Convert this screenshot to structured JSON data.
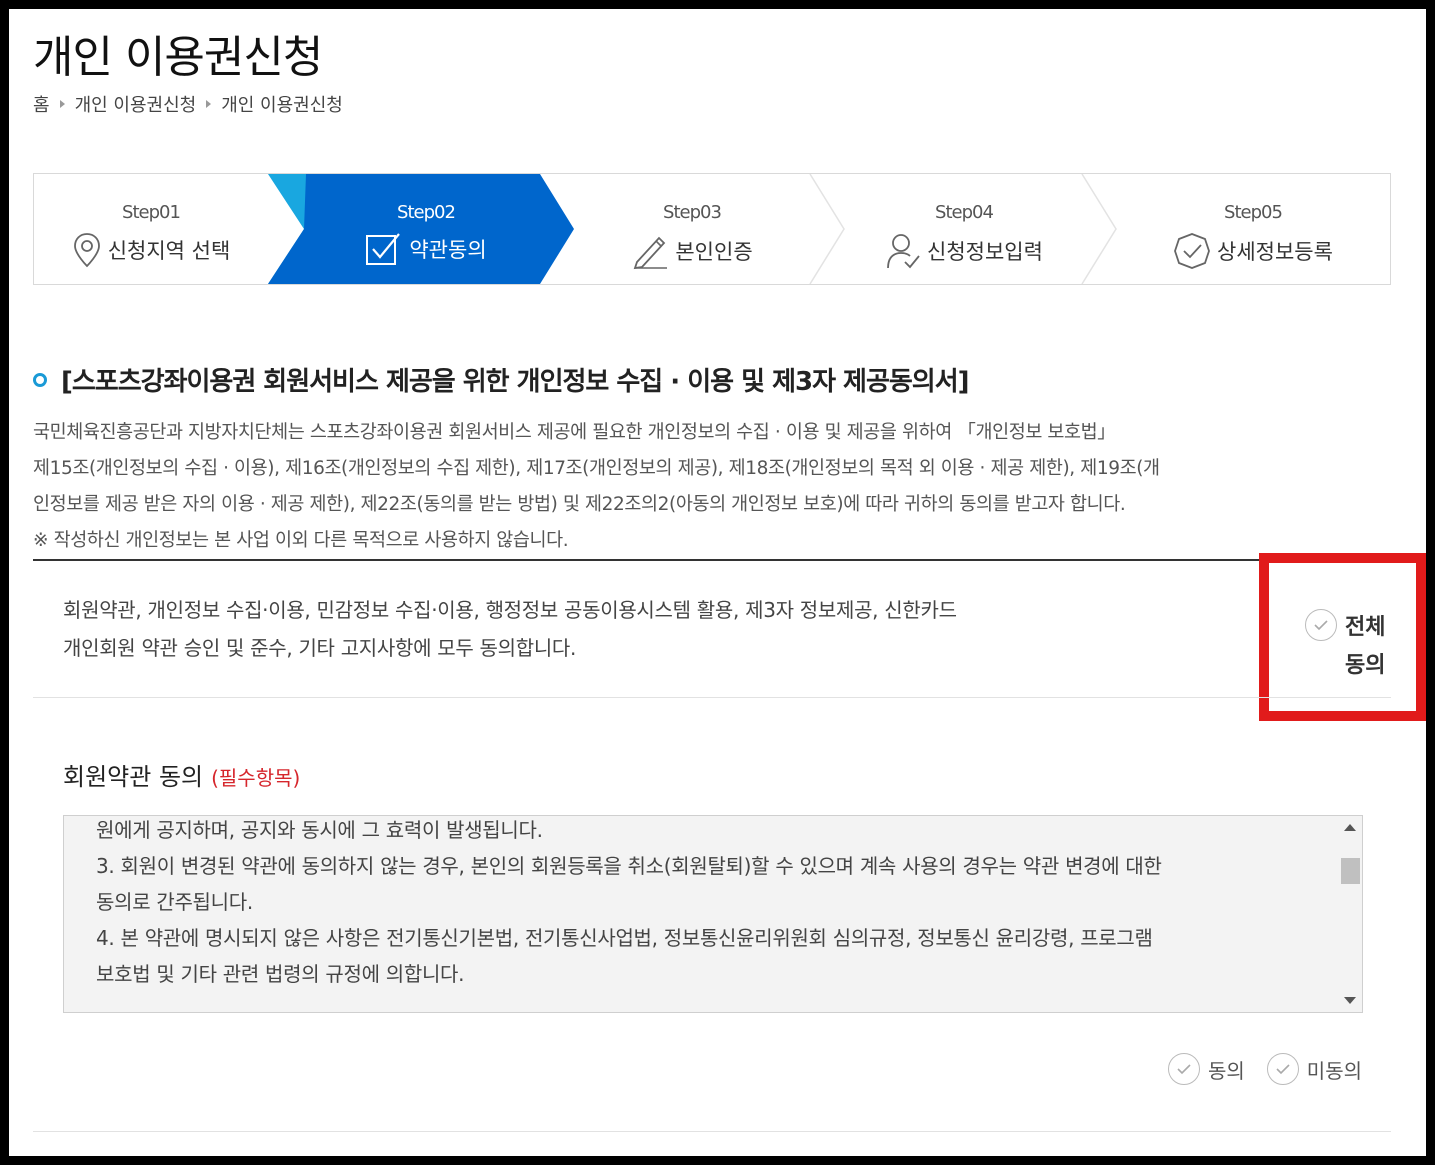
{
  "page": {
    "title": "개인 이용권신청",
    "breadcrumb": [
      "홈",
      "개인 이용권신청",
      "개인 이용권신청"
    ]
  },
  "steps": [
    {
      "num": "Step01",
      "label": "신청지역 선택",
      "icon": "location-pin-icon",
      "active": false
    },
    {
      "num": "Step02",
      "label": "약관동의",
      "icon": "checkbox-icon",
      "active": true
    },
    {
      "num": "Step03",
      "label": "본인인증",
      "icon": "pencil-icon",
      "active": false
    },
    {
      "num": "Step04",
      "label": "신청정보입력",
      "icon": "user-check-icon",
      "active": false
    },
    {
      "num": "Step05",
      "label": "상세정보등록",
      "icon": "check-badge-icon",
      "active": false
    }
  ],
  "section": {
    "title": "[스포츠강좌이용권 회원서비스 제공을 위한 개인정보 수집 · 이용 및 제3자 제공동의서]",
    "intro_lines": [
      "국민체육진흥공단과 지방자치단체는 스포츠강좌이용권 회원서비스 제공에 필요한 개인정보의 수집 ·  이용 및 제공을 위하여 「개인정보 보호법」",
      "제15조(개인정보의 수집 · 이용), 제16조(개인정보의 수집 제한), 제17조(개인정보의 제공), 제18조(개인정보의 목적 외 이용 · 제공 제한), 제19조(개",
      "인정보를 제공 받은 자의 이용 · 제공 제한), 제22조(동의를 받는 방법) 및 제22조의2(아동의 개인정보 보호)에 따라 귀하의 동의를 받고자 합니다.",
      "※ 작성하신 개인정보는 본 사업 이외 다른 목적으로 사용하지 않습니다."
    ]
  },
  "agree_all": {
    "lines": [
      "회원약관, 개인정보 수집·이용, 민감정보 수집·이용, 행정정보 공동이용시스템 활용, 제3자 정보제공, 신한카드",
      "개인회원 약관 승인 및 준수, 기타 고지사항에 모두 동의합니다."
    ],
    "label_line1": "전체",
    "label_line2": "동의"
  },
  "terms": {
    "title": "회원약관 동의",
    "required": "(필수항목)",
    "lines": [
      "원에게 공지하며, 공지와 동시에 그 효력이 발생됩니다.",
      "3. 회원이 변경된 약관에 동의하지 않는 경우, 본인의 회원등록을 취소(회원탈퇴)할 수 있으며 계속 사용의 경우는 약관 변경에 대한",
      "동의로 간주됩니다.",
      "4. 본 약관에 명시되지 않은 사항은 전기통신기본법, 전기통신사업법, 정보통신윤리위원회 심의규정, 정보통신 윤리강령, 프로그램",
      "보호법 및 기타 관련 법령의 규정에 의합니다."
    ],
    "agree_label": "동의",
    "disagree_label": "미동의"
  },
  "colors": {
    "active_step": "#0066cc",
    "active_step_edge": "#19a7e0",
    "accent_dot": "#1a9ad6",
    "required": "#d6262c",
    "highlight_box": "#e11b1b"
  }
}
